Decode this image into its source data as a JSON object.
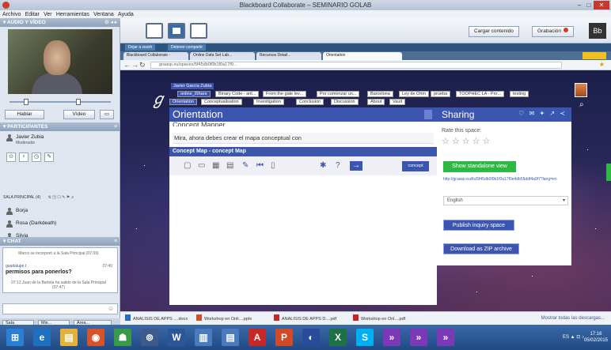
{
  "window": {
    "title": "Blackboard Collaborate – SEMINARIO GOLAB",
    "min": "–",
    "max": "□",
    "close": "✕"
  },
  "menu": [
    "Archivo",
    "Editar",
    "Ver",
    "Herramientas",
    "Ventana",
    "Ayuda"
  ],
  "audio_video": {
    "header": "AUDIO Y VÍDEO",
    "talk_label": "Hablar",
    "video_label": "Vídeo"
  },
  "participants": {
    "header": "PARTICIPANTES",
    "moderator": {
      "name": "Javier Zubia",
      "sub": "Moderador"
    },
    "room_label": "SALA PRINCIPAL (4)",
    "list": [
      "Borja",
      "Rosa (Darkdeath)",
      "Silvia"
    ]
  },
  "chat": {
    "header": "CHAT",
    "system_line_1": "Marco se incorporó a la Sala Principal (07:09)",
    "user": "guadalupe.t",
    "time": "07:40",
    "message": "permisos para ponerlos?",
    "system_line_2": "07:12 Juan de la Bartola ha salido de la Sala Principal (07:47)"
  },
  "bottom_tabs": [
    "Sala",
    "Mis...",
    "Área..."
  ],
  "toolbar": {
    "load_content": "Cargar contenido",
    "recording": "Grabación"
  },
  "share_bar": {
    "stop": "Dejar a ssssh",
    "share": "Detener compartir"
  },
  "browser": {
    "tabs": [
      "Blackboard Collaborate -",
      "Online Data Set Lab...",
      "Recursos Detail...",
      "Orientation"
    ],
    "url": "graasp.eu/spaces/5f45db0f0b1f0a17f0...",
    "star": "★"
  },
  "graasp": {
    "logo": "ℊ",
    "owner": "Javier García Zubía",
    "tabs_row1": [
      "online_iShare",
      "Binary Code - arit...",
      "From the gate lev...",
      "Por comenzar un...",
      "Barcelona",
      "Ley de Ohm",
      "prueba",
      "TOOPHEC LA - Pro...",
      "testing"
    ],
    "tabs_row2": [
      "Orientation",
      "Conceptualisation",
      "Investigation",
      "Conclusion",
      "Discussion",
      "About",
      "Vault"
    ],
    "search_icon": "⌕"
  },
  "orientation": {
    "title": "Orientation",
    "subtitle": "Concept Mapper",
    "prompt": "Mira, ahora debes crear el mapa conceptual con",
    "concept_map_title": "Concept Map - concept Map",
    "concept_button": "concept",
    "tools": [
      "▢",
      "▭",
      "▦",
      "▤",
      "✎",
      "⏮",
      "▯",
      "✱",
      "?",
      "→"
    ]
  },
  "sharing": {
    "title": "Sharing",
    "header_icons": "♡ ✉ ✦ ↗ ≺",
    "rate_label": "Rate this space:",
    "stars": "☆☆☆☆☆",
    "standalone_button": "Show standalone view",
    "link": "http://graasp.eu/ils/5f45db0f0b1f0a17f0e4db55ddf4a9f7?lang=en",
    "language": "English",
    "publish_button": "Publish inquiry space",
    "download_button": "Download as ZIP archive"
  },
  "downloads": {
    "items": [
      "ANALISIS DE APPS ....docx",
      "Workshop en Onli....pptx",
      "ANALISIS DE APPS D....pdf",
      "Workshop en Onl....pdf"
    ],
    "show_all": "Mostrar todas las descargas..."
  },
  "taskbar": {
    "apps": [
      "⊞",
      "e",
      "▤",
      "◉",
      "☗",
      "⊚",
      "W",
      "▥",
      "▤",
      "A",
      "P",
      "◐",
      "X",
      "S",
      "»",
      "»",
      "»"
    ],
    "tray": "ES ▲ ⊡ ♪",
    "time": "17:16",
    "date": "05/02/2015"
  },
  "colors": {
    "graasp_blue": "#3c56b0",
    "standalone_green": "#2db843",
    "taskbar_blue": "#214a84"
  }
}
